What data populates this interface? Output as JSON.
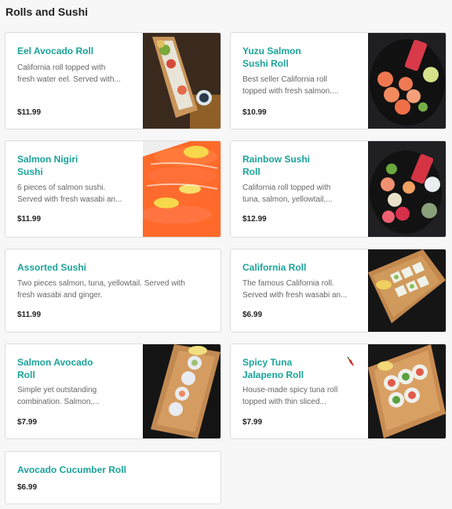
{
  "section": {
    "title": "Rolls and Sushi"
  },
  "items": [
    {
      "name_line1": "Eel Avocado Roll",
      "name_line2": "",
      "desc_line1": "California roll topped with",
      "desc_line2": "fresh water eel. Served with...",
      "price": "$11.99",
      "image": "eel-avocado-roll-photo"
    },
    {
      "name_line1": "Yuzu Salmon",
      "name_line2": "Sushi Roll",
      "desc_line1": "Best seller California roll",
      "desc_line2": "topped with fresh salmon....",
      "price": "$10.99",
      "image": "yuzu-salmon-roll-photo"
    },
    {
      "name_line1": "Salmon Nigiri",
      "name_line2": "Sushi",
      "desc_line1": "6 pieces of salmon sushi.",
      "desc_line2": "Served with fresh wasabi an...",
      "price": "$11.99",
      "image": "salmon-nigiri-photo"
    },
    {
      "name_line1": "Rainbow Sushi",
      "name_line2": "Roll",
      "desc_line1": "California roll topped with",
      "desc_line2": "tuna, salmon, yellowtail,...",
      "price": "$12.99",
      "image": "rainbow-roll-photo"
    },
    {
      "name_line1": "Assorted Sushi",
      "name_line2": "",
      "desc_line1": "Two pieces salmon, tuna, yellowtail. Served with",
      "desc_line2": "fresh wasabi and ginger.",
      "price": "$11.99",
      "image": ""
    },
    {
      "name_line1": "California Roll",
      "name_line2": "",
      "desc_line1": "The famous California roll.",
      "desc_line2": "Served with fresh wasabi an...",
      "price": "$6.99",
      "image": "california-roll-photo"
    },
    {
      "name_line1": "Salmon Avocado",
      "name_line2": "Roll",
      "desc_line1": "Simple yet outstanding",
      "desc_line2": "combination. Salmon,...",
      "price": "$7.99",
      "image": "salmon-avocado-roll-photo"
    },
    {
      "name_line1": "Spicy Tuna",
      "name_line2": "Jalapeno Roll",
      "desc_line1": "House-made spicy tuna roll",
      "desc_line2": "topped with thin sliced...",
      "price": "$7.99",
      "image": "spicy-tuna-roll-photo",
      "spicy_icon": "chili-pepper-icon"
    },
    {
      "name_line1": "Avocado Cucumber Roll",
      "name_line2": "",
      "desc_line1": "",
      "desc_line2": "",
      "price": "$6.99",
      "image": ""
    }
  ],
  "colors": {
    "accent": "#1aa39a",
    "background": "#f7f7f7",
    "card_border": "#dddddd",
    "pepper": "#d0271d"
  }
}
